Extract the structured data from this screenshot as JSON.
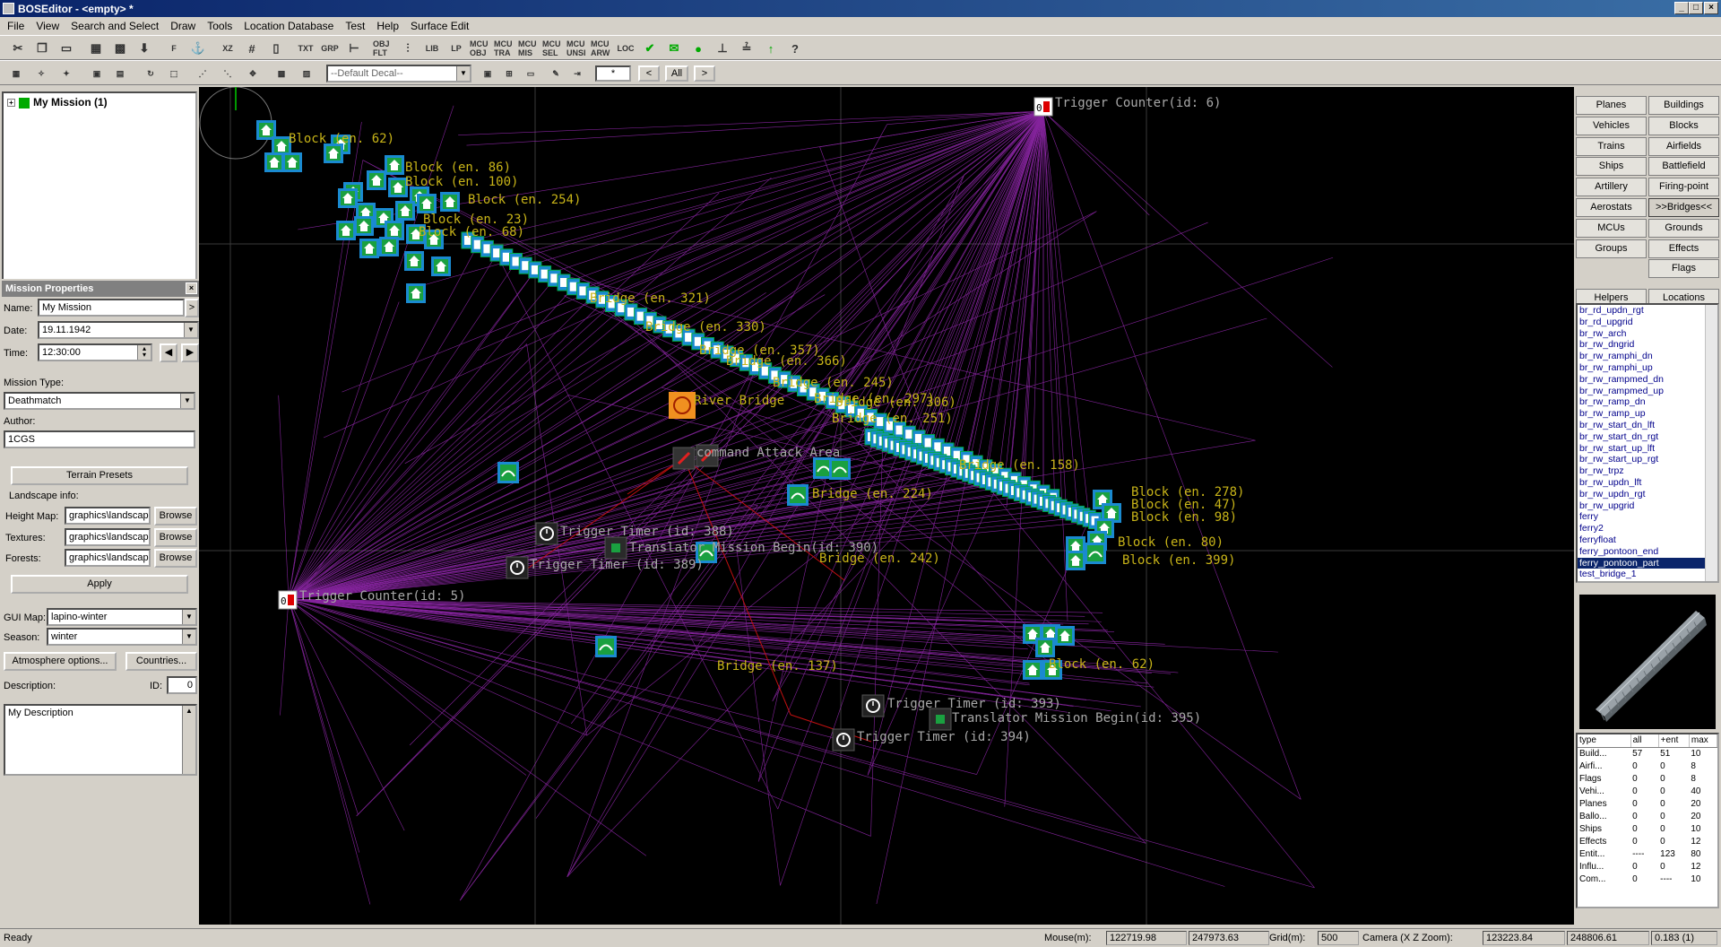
{
  "window": {
    "title": "BOSEditor - <empty> *"
  },
  "menu": [
    "File",
    "View",
    "Search and Select",
    "Draw",
    "Tools",
    "Location Database",
    "Test",
    "Help",
    "Surface Edit"
  ],
  "toolbar1": [
    "cut-icon",
    "copy-icon",
    "paste-icon",
    "group-icon",
    "ungroup-icon",
    "download-icon",
    "F",
    "anchor-icon",
    "XZ",
    "grid-icon",
    "frame-icon",
    "TXT",
    "GRP",
    "ruler-icon",
    "OBJ FLT",
    "filter-icon",
    "LIB",
    "LP",
    "MCU OBJ",
    "MCU TRA",
    "MCU MIS",
    "MCU SEL",
    "MCU UNSI",
    "MCU ARW",
    "LOC",
    "check-icon",
    "mail-icon",
    "dot-icon",
    "ruler2-icon",
    "ruler3-icon",
    "arrow-up-icon",
    "help-icon"
  ],
  "toolbar2": {
    "decal_placeholder": "--Default Decal--",
    "star_field": "*",
    "nav_buttons": [
      "<",
      "All",
      ">"
    ]
  },
  "tree": {
    "root": "My Mission (1)"
  },
  "mission_properties": {
    "header": "Mission Properties",
    "name_label": "Name:",
    "name": "My Mission",
    "date_label": "Date:",
    "date": "19.11.1942",
    "time_label": "Time:",
    "time": "12:30:00",
    "type_label": "Mission Type:",
    "type": "Deathmatch",
    "author_label": "Author:",
    "author": "1CGS",
    "terrain_presets": "Terrain Presets",
    "landscape_label": "Landscape info:",
    "heightmap_label": "Height Map:",
    "heightmap": "graphics\\landscape",
    "textures_label": "Textures:",
    "textures": "graphics\\landscape",
    "forests_label": "Forests:",
    "forests": "graphics\\landscape",
    "browse": "Browse",
    "apply": "Apply",
    "guimap_label": "GUI Map:",
    "guimap": "lapino-winter",
    "season_label": "Season:",
    "season": "winter",
    "atmosphere": "Atmosphere options...",
    "countries": "Countries...",
    "description_label": "Description:",
    "id_label": "ID:",
    "id": "0",
    "description": "My Description"
  },
  "map": {
    "labels": [
      {
        "t": "Trigger Counter(id: 6)",
        "c": "gray"
      },
      {
        "t": "Trigger Counter(id: 5)",
        "c": "gray"
      },
      {
        "t": "Block (en. 62)",
        "c": "yellow"
      },
      {
        "t": "Block (en. 86)",
        "c": "yellow"
      },
      {
        "t": "Block (en. 254)",
        "c": "yellow"
      },
      {
        "t": "Block (en. 23)",
        "c": "yellow"
      },
      {
        "t": "Block (en. 68)",
        "c": "yellow"
      },
      {
        "t": "Block (en. 100)",
        "c": "yellow"
      },
      {
        "t": "Bridge (en. 321)",
        "c": "yellow"
      },
      {
        "t": "Bridge (en. 330)",
        "c": "yellow"
      },
      {
        "t": "Bridge (en. 357)",
        "c": "yellow"
      },
      {
        "t": "Bridge (en. 366)",
        "c": "yellow"
      },
      {
        "t": "Bridge (en. 245)",
        "c": "yellow"
      },
      {
        "t": "Bridge (en. 297)",
        "c": "yellow"
      },
      {
        "t": "Bridge (en. 306)",
        "c": "yellow"
      },
      {
        "t": "Bridge (en. 251)",
        "c": "yellow"
      },
      {
        "t": "River Bridge",
        "c": "yellow"
      },
      {
        "t": "command Attack Area",
        "c": "gray"
      },
      {
        "t": "Bridge (en. 224)",
        "c": "yellow"
      },
      {
        "t": "Bridge (en. 158)",
        "c": "yellow"
      },
      {
        "t": "Block (en. 278)",
        "c": "yellow"
      },
      {
        "t": "Block (en. 47)",
        "c": "yellow"
      },
      {
        "t": "Block (en. 98)",
        "c": "yellow"
      },
      {
        "t": "Block (en. 80)",
        "c": "yellow"
      },
      {
        "t": "Block (en. 399)",
        "c": "yellow"
      },
      {
        "t": "Trigger Timer (id: 388)",
        "c": "gray"
      },
      {
        "t": "Translator Mission Begin(id: 390)",
        "c": "gray"
      },
      {
        "t": "Trigger Timer (id: 389)",
        "c": "gray"
      },
      {
        "t": "Bridge (en. 242)",
        "c": "yellow"
      },
      {
        "t": "Bridge (en. 137)",
        "c": "yellow"
      },
      {
        "t": "Block (en. 62)",
        "c": "yellow"
      },
      {
        "t": "Trigger Timer (id: 393)",
        "c": "gray"
      },
      {
        "t": "Translator Mission Begin(id: 395)",
        "c": "gray"
      },
      {
        "t": "Trigger Timer (id: 394)",
        "c": "gray"
      }
    ]
  },
  "categories": [
    [
      "Planes",
      "Buildings"
    ],
    [
      "Vehicles",
      "Blocks"
    ],
    [
      "Trains",
      "Airfields"
    ],
    [
      "Ships",
      "Battlefield"
    ],
    [
      "Artillery",
      "Firing-point"
    ],
    [
      "Aerostats",
      ">>Bridges<<"
    ],
    [
      "MCUs",
      "Grounds"
    ],
    [
      "Groups",
      "Effects"
    ],
    [
      "",
      "Flags"
    ],
    [
      "Helpers",
      "Locations"
    ]
  ],
  "items": [
    "br_rd_updn_rgt",
    "br_rd_upgrid",
    "br_rw_arch",
    "br_rw_dngrid",
    "br_rw_ramphi_dn",
    "br_rw_ramphi_up",
    "br_rw_rampmed_dn",
    "br_rw_rampmed_up",
    "br_rw_ramp_dn",
    "br_rw_ramp_up",
    "br_rw_start_dn_lft",
    "br_rw_start_dn_rgt",
    "br_rw_start_up_lft",
    "br_rw_start_up_rgt",
    "br_rw_trpz",
    "br_rw_updn_lft",
    "br_rw_updn_rgt",
    "br_rw_upgrid",
    "ferry",
    "ferry2",
    "ferryfloat",
    "ferry_pontoon_end",
    "ferry_pontoon_part",
    "test_bridge_1"
  ],
  "selected_item": "ferry_pontoon_part",
  "stats": {
    "header": [
      "type",
      "all",
      "+ent",
      "max"
    ],
    "rows": [
      [
        "Build...",
        "57",
        "51",
        "10"
      ],
      [
        "Airfi...",
        "0",
        "0",
        "8"
      ],
      [
        "Flags",
        "0",
        "0",
        "8"
      ],
      [
        "Vehi...",
        "0",
        "0",
        "40"
      ],
      [
        "Planes",
        "0",
        "0",
        "20"
      ],
      [
        "Ballo...",
        "0",
        "0",
        "20"
      ],
      [
        "Ships",
        "0",
        "0",
        "10"
      ],
      [
        "Effects",
        "0",
        "0",
        "12"
      ],
      [
        "Entit...",
        "----",
        "123",
        "80"
      ],
      [
        "Influ...",
        "0",
        "0",
        "12"
      ],
      [
        "Com...",
        "0",
        "----",
        "10"
      ]
    ]
  },
  "status": {
    "ready": "Ready",
    "mouse_label": "Mouse(m):",
    "mouse_x": "122719.98",
    "mouse_z": "247973.63",
    "grid_label": "Grid(m):",
    "grid": "500",
    "camera_label": "Camera (X Z Zoom):",
    "cam_x": "123223.84",
    "cam_z": "248806.61",
    "zoom": "0.183 (1)"
  }
}
